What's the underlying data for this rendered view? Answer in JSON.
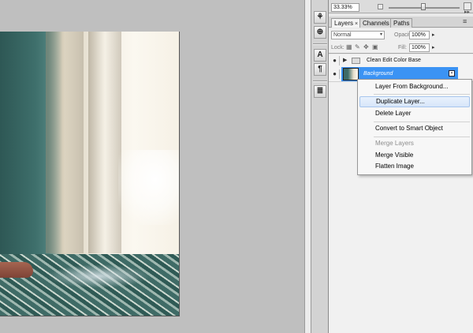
{
  "navigator": {
    "zoom": "33.33%"
  },
  "tabs": [
    {
      "label": "Layers",
      "close": "×"
    },
    {
      "label": "Channels"
    },
    {
      "label": "Paths"
    }
  ],
  "options": {
    "blend_mode": "Normal",
    "opacity_label": "Opacity:",
    "opacity_value": "100%",
    "lock_label": "Lock:",
    "fill_label": "Fill:",
    "fill_value": "100%"
  },
  "layers": [
    {
      "name": "Clean Edit Color Base",
      "type": "group"
    },
    {
      "name": "Background",
      "type": "image",
      "selected": true,
      "locked": true
    }
  ],
  "context_menu": {
    "items": [
      {
        "label": "Layer From Background...",
        "enabled": true
      },
      {
        "label": "Duplicate Layer...",
        "enabled": true,
        "hover": true
      },
      {
        "label": "Delete Layer",
        "enabled": true
      },
      {
        "label": "Convert to Smart Object",
        "enabled": true
      },
      {
        "label": "Merge Layers",
        "enabled": false
      },
      {
        "label": "Merge Visible",
        "enabled": true
      },
      {
        "label": "Flatten Image",
        "enabled": true
      }
    ]
  },
  "colors": {
    "selection": "#3b93f4",
    "menu_hover": "#d7e6f9",
    "panel_bg": "#e9e9e9",
    "workspace_bg": "#bfbfbf"
  },
  "icons": [
    "eye-icon",
    "folder-icon",
    "lock-icon",
    "brush-icon",
    "move-icon",
    "character-icon",
    "paragraph-icon"
  ]
}
